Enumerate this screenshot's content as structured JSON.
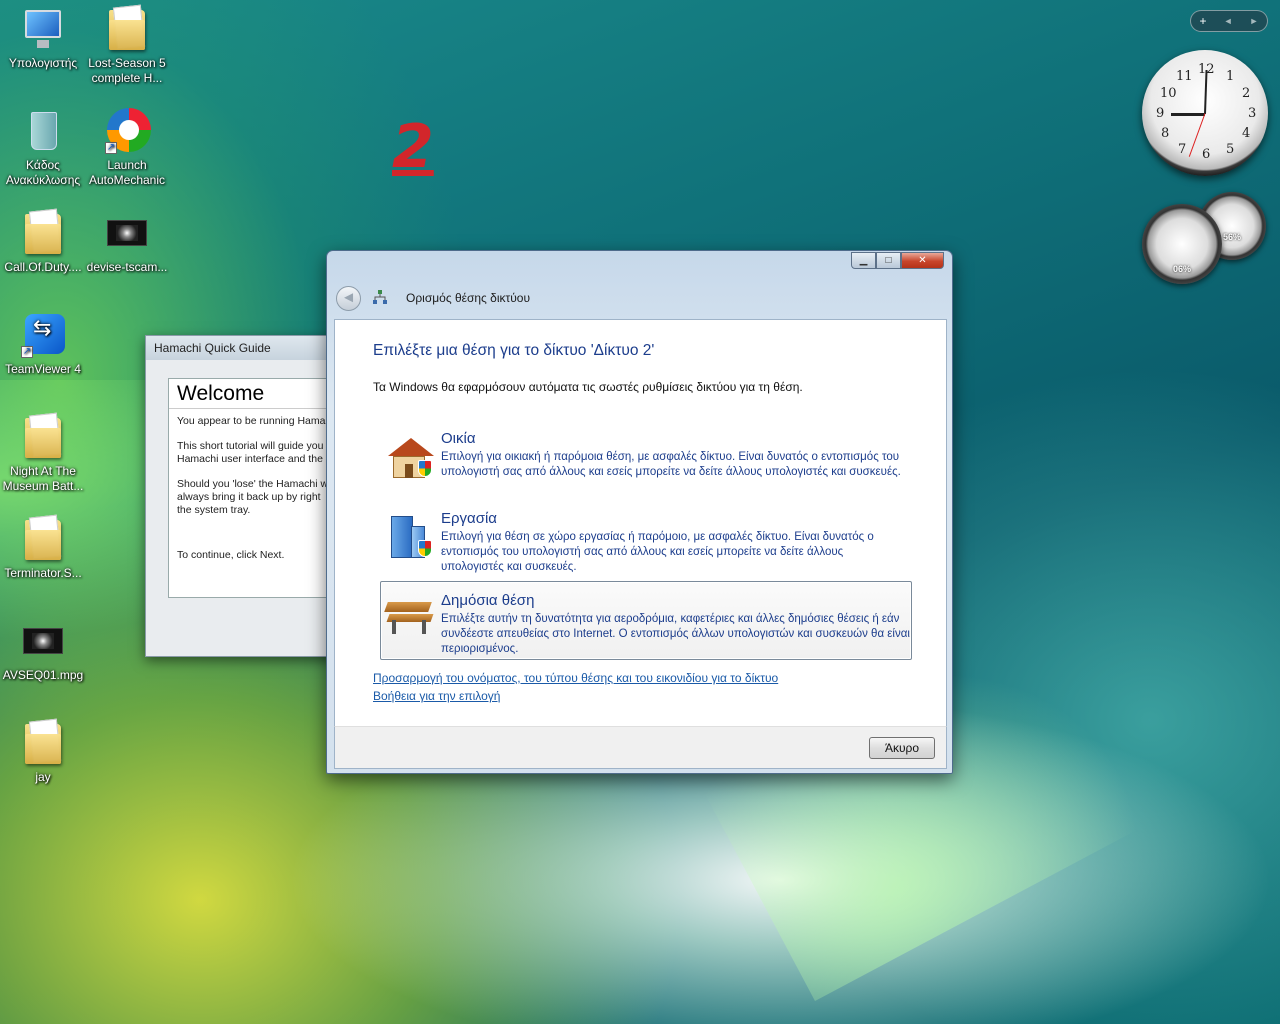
{
  "desktop": {
    "icons": [
      {
        "label": "Υπολογιστής",
        "icon": "computer-icon"
      },
      {
        "label": "Lost-Season 5 complete H...",
        "icon": "folder-icon"
      },
      {
        "label": "Κάδος Ανακύκλωσης",
        "icon": "recycle-bin-icon"
      },
      {
        "label": "Launch AutoMechanic",
        "icon": "automechanic-icon"
      },
      {
        "label": "Call.Of.Duty....",
        "icon": "folder-icon"
      },
      {
        "label": "devise-tscam...",
        "icon": "video-file-icon"
      },
      {
        "label": "TeamViewer 4",
        "icon": "teamviewer-icon"
      },
      {
        "label": "Night At The Museum Batt...",
        "icon": "folder-icon"
      },
      {
        "label": "Terminator.S...",
        "icon": "folder-icon"
      },
      {
        "label": "AVSEQ01.mpg",
        "icon": "video-file-icon"
      },
      {
        "label": "jay",
        "icon": "folder-icon"
      }
    ],
    "annotation": "2"
  },
  "sidebar": {
    "add_label": "+",
    "prev_label": "◄",
    "next_label": "►",
    "clock_numbers": [
      "12",
      "1",
      "2",
      "3",
      "4",
      "5",
      "6",
      "7",
      "8",
      "9",
      "10",
      "11"
    ],
    "cpu_meter": "06%",
    "memory_meter": "56%"
  },
  "hamachi": {
    "title": "Hamachi Quick Guide",
    "heading": "Welcome",
    "para1": "You appear to be running Hama",
    "para2": "This short tutorial will guide you\nHamachi user interface and the",
    "para3": "Should you 'lose' the Hamachi w\nalways bring it back up by right\nthe system tray.",
    "para4": "To continue, click Next."
  },
  "dialog": {
    "title": "Ορισμός θέσης δικτύου",
    "main_instruction": "Επιλέξτε μια θέση για το δίκτυο 'Δίκτυο  2'",
    "sub_instruction": "Τα Windows θα εφαρμόσουν αυτόματα τις σωστές ρυθμίσεις δικτύου για τη θέση.",
    "options": [
      {
        "name": "Οικία",
        "desc": "Επιλογή για οικιακή ή παρόμοια θέση, με ασφαλές δίκτυο. Είναι δυνατός ο εντοπισμός του υπολογιστή σας από άλλους και εσείς μπορείτε να δείτε άλλους υπολογιστές και συσκευές.",
        "icon": "home-network-icon"
      },
      {
        "name": "Εργασία",
        "desc": "Επιλογή για θέση σε χώρο εργασίας ή παρόμοιο, με ασφαλές δίκτυο. Είναι δυνατός ο εντοπισμός του υπολογιστή σας από άλλους και εσείς μπορείτε να δείτε άλλους υπολογιστές και συσκευές.",
        "icon": "work-network-icon"
      },
      {
        "name": "Δημόσια θέση",
        "desc": "Επιλέξτε αυτήν τη δυνατότητα για αεροδρόμια, καφετέριες και άλλες δημόσιες θέσεις ή εάν συνδέεστε απευθείας στο Internet. Ο εντοπισμός άλλων υπολογιστών και συσκευών θα είναι περιορισμένος.",
        "icon": "public-network-icon"
      }
    ],
    "link_customize": "Προσαρμογή του ονόματος, του τύπου θέσης και του εικονιδίου για το δίκτυο",
    "link_help": "Βοήθεια για την επιλογή",
    "cancel_label": "Άκυρο",
    "min_label": "▁",
    "max_label": "□",
    "close_label": "✕",
    "back_label": "◄"
  }
}
